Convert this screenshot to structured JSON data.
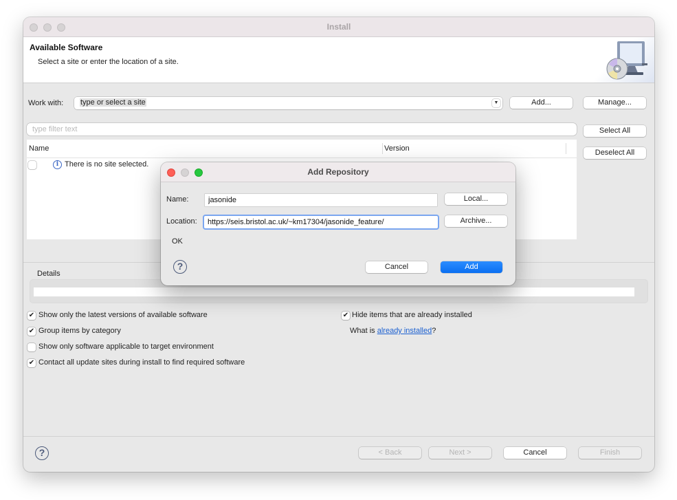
{
  "window": {
    "title": "Install",
    "header_title": "Available Software",
    "header_subtitle": "Select a site or enter the location of a site.",
    "header_icon": "install-software-icon"
  },
  "work_with": {
    "label": "Work with:",
    "value": "type or select a site",
    "add_label": "Add...",
    "manage_label": "Manage..."
  },
  "filter": {
    "placeholder": "type filter text",
    "value": ""
  },
  "side_buttons": {
    "select_all": "Select All",
    "deselect_all": "Deselect All"
  },
  "table": {
    "columns": [
      "Name",
      "Version"
    ],
    "rows": [
      {
        "checked": false,
        "icon": "info-icon",
        "name": "There is no site selected.",
        "version": ""
      }
    ]
  },
  "details": {
    "label": "Details"
  },
  "options": {
    "left": [
      {
        "label": "Show only the latest versions of available software",
        "checked": true
      },
      {
        "label": "Group items by category",
        "checked": true
      },
      {
        "label": "Show only software applicable to target environment",
        "checked": false
      },
      {
        "label": "Contact all update sites during install to find required software",
        "checked": true
      }
    ],
    "right": [
      {
        "label": "Hide items that are already installed",
        "checked": true
      }
    ],
    "already_installed_prefix": "What is ",
    "already_installed_link": "already installed",
    "already_installed_suffix": "?"
  },
  "footer": {
    "back": "< Back",
    "next": "Next >",
    "cancel": "Cancel",
    "finish": "Finish"
  },
  "dialog": {
    "title": "Add Repository",
    "name_label": "Name:",
    "name_value": "jasonide",
    "location_label": "Location:",
    "location_value": "https://seis.bristol.ac.uk/~km17304/jasonide_feature/",
    "local_button": "Local...",
    "archive_button": "Archive...",
    "status": "OK",
    "cancel_button": "Cancel",
    "add_button": "Add"
  },
  "colors": {
    "traffic_close": "#fe5f57",
    "traffic_minimize": "#d6d3d4",
    "traffic_zoom": "#28c840",
    "primary_button": "#0a6ff1",
    "link": "#1a5fd0"
  }
}
